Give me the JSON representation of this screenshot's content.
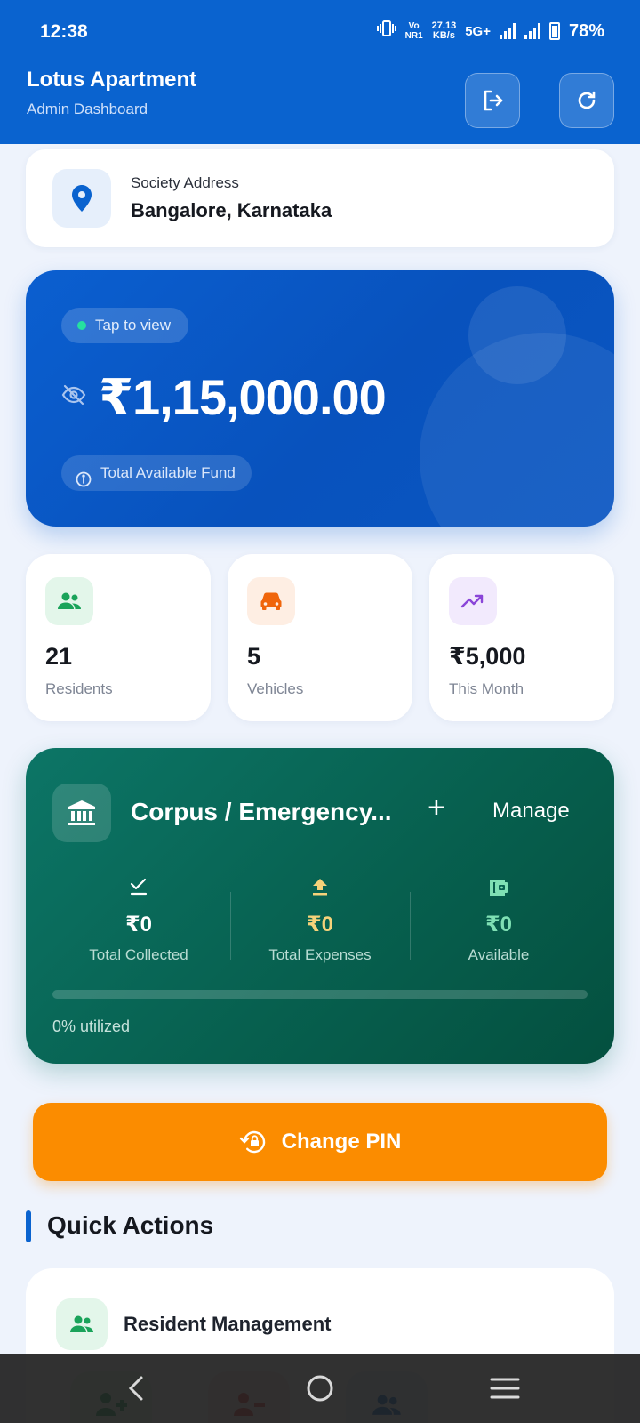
{
  "status_bar": {
    "time": "12:38",
    "network_top": "Vo",
    "network_bottom": "NR1",
    "speed_top": "27.13",
    "speed_bottom": "KB/s",
    "network_type": "5G+",
    "battery": "78%"
  },
  "header": {
    "title": "Lotus Apartment",
    "subtitle": "Admin Dashboard",
    "logout_icon": "logout-icon",
    "refresh_icon": "refresh-icon"
  },
  "address": {
    "label": "Society Address",
    "value": "Bangalore, Karnataka",
    "icon": "location-pin-icon"
  },
  "fund": {
    "tap_label": "Tap to view",
    "amount": "₹1,15,000.00",
    "label": "Total Available Fund"
  },
  "stats": [
    {
      "value": "21",
      "label": "Residents",
      "icon": "people-icon",
      "color": "#1aa35a",
      "bg": "#e3f6ea"
    },
    {
      "value": "5",
      "label": "Vehicles",
      "icon": "car-icon",
      "color": "#f0650b",
      "bg": "#feeee3"
    },
    {
      "value": "₹5,000",
      "label": "This Month",
      "icon": "trending-up-icon",
      "color": "#8a45d8",
      "bg": "#f2eafd"
    }
  ],
  "corpus": {
    "title": "Corpus / Emergency...",
    "add_label": "+",
    "manage_label": "Manage",
    "columns": [
      {
        "value": "₹0",
        "label": "Total Collected",
        "icon": "check-icon",
        "color": "#ffffff"
      },
      {
        "value": "₹0",
        "label": "Total Expenses",
        "icon": "upload-icon",
        "color": "#f6d27a"
      },
      {
        "value": "₹0",
        "label": "Available",
        "icon": "wallet-icon",
        "color": "#7fe0b4"
      }
    ],
    "utilized_fraction": 0,
    "utilized_label": "0% utilized"
  },
  "change_pin": {
    "label": "Change PIN",
    "icon": "lock-reset-icon"
  },
  "quick_actions": {
    "title": "Quick Actions",
    "sections": [
      {
        "label": "Resident Management",
        "icon": "people-icon"
      }
    ]
  },
  "colors": {
    "primary": "#0a63cf",
    "corpus": "#07604f",
    "accent_orange": "#fb8c00"
  }
}
